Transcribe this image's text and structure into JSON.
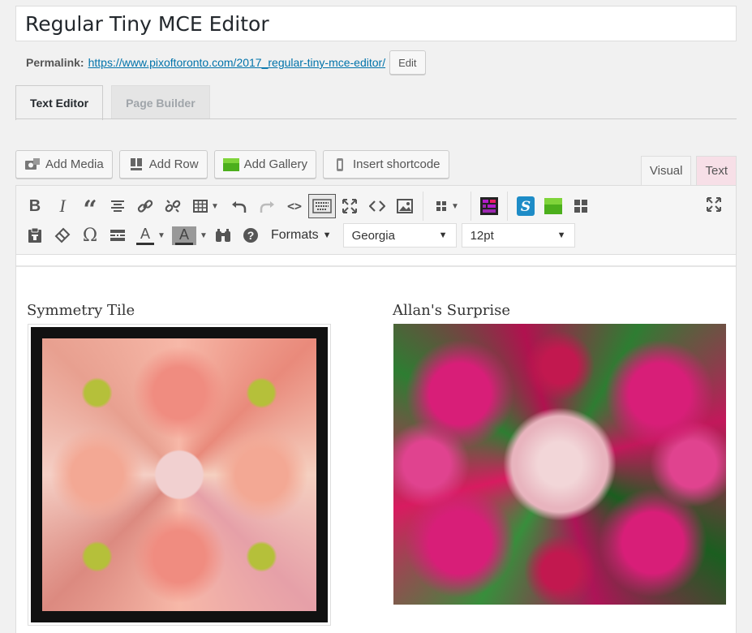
{
  "post": {
    "title": "Regular Tiny MCE Editor",
    "permalink_label": "Permalink:",
    "permalink_url": "https://www.pixoftoronto.com/2017_regular-tiny-mce-editor/",
    "edit_label": "Edit"
  },
  "editor_tabs": [
    {
      "label": "Text Editor",
      "active": true
    },
    {
      "label": "Page Builder",
      "active": false
    }
  ],
  "media_buttons": {
    "add_media": "Add Media",
    "add_row": "Add Row",
    "add_gallery": "Add Gallery",
    "insert_shortcode": "Insert shortcode"
  },
  "mode_tabs": {
    "visual": "Visual",
    "text": "Text"
  },
  "toolbar": {
    "formats_label": "Formats",
    "font_family": "Georgia",
    "font_size": "12pt"
  },
  "content": {
    "left_title": "Symmetry Tile",
    "right_title": "Allan's Surprise"
  },
  "colors": {
    "link": "#0073aa",
    "text_tab_bg": "#f7dfe7",
    "toolbar_bg": "#f5f5f5"
  }
}
